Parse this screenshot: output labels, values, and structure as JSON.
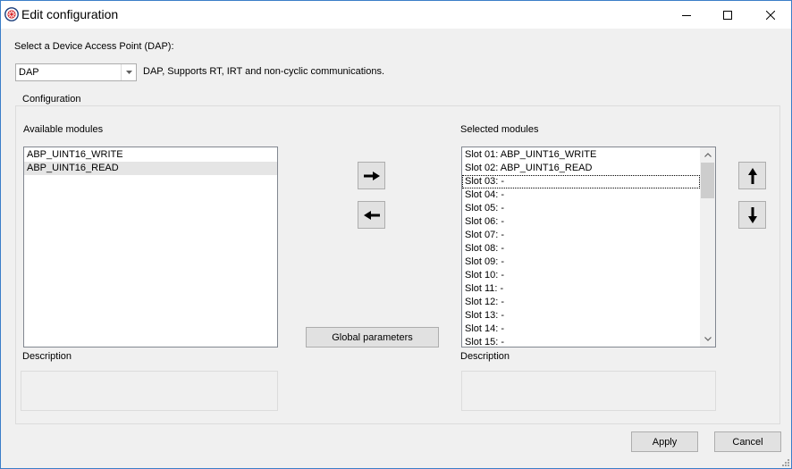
{
  "window": {
    "title": "Edit configuration",
    "icon": "app-gear-icon",
    "controls": [
      "minimize-icon",
      "maximize-icon",
      "close-icon"
    ]
  },
  "dap": {
    "label": "Select a Device Access Point (DAP):",
    "selected": "DAP",
    "description": "DAP, Supports RT, IRT and non-cyclic communications."
  },
  "configuration": {
    "title": "Configuration",
    "available": {
      "label": "Available modules",
      "items": [
        "ABP_UINT16_WRITE",
        "ABP_UINT16_READ"
      ]
    },
    "selected": {
      "label": "Selected modules",
      "items": [
        "Slot 01: ABP_UINT16_WRITE",
        "Slot 02: ABP_UINT16_READ",
        "Slot 03: -",
        "Slot 04: -",
        "Slot 05: -",
        "Slot 06: -",
        "Slot 07: -",
        "Slot 08: -",
        "Slot 09: -",
        "Slot 10: -",
        "Slot 11: -",
        "Slot 12: -",
        "Slot 13: -",
        "Slot 14: -",
        "Slot 15: -"
      ]
    },
    "global_parameters_label": "Global parameters",
    "description_label": "Description",
    "description_label_right": "Description"
  },
  "footer": {
    "apply_label": "Apply",
    "cancel_label": "Cancel"
  },
  "colors": {
    "window_border": "#3b7ec8",
    "background": "#f0f0f0",
    "hover_row": "#e5e5e5"
  }
}
